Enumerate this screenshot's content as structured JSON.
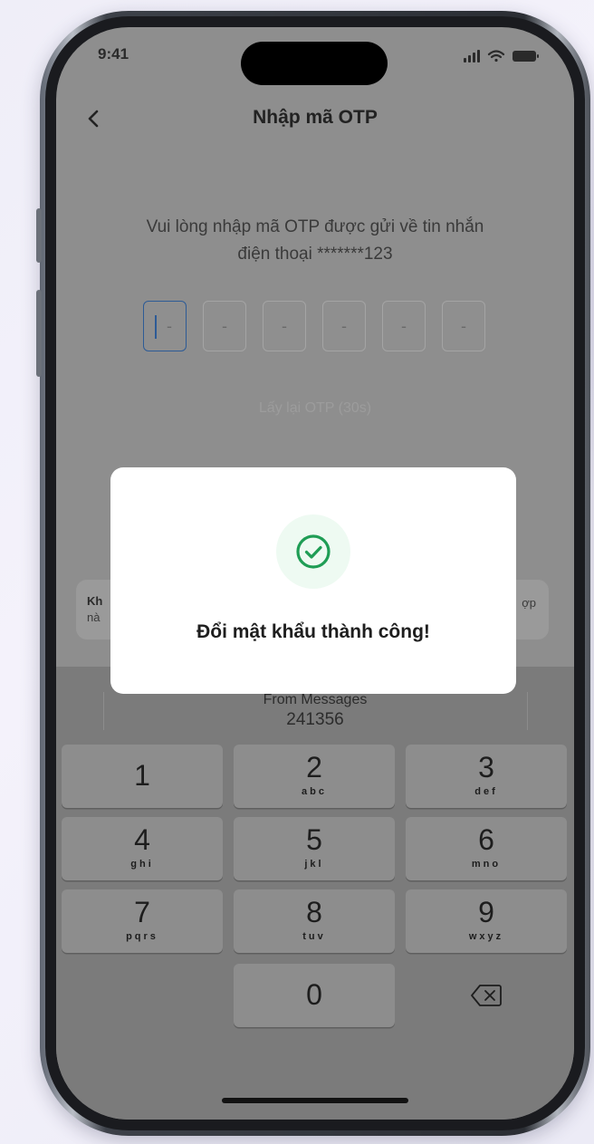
{
  "status_bar": {
    "time": "9:41"
  },
  "header": {
    "title": "Nhập mã OTP"
  },
  "instruction": {
    "line1": "Vui lòng nhập mã OTP được gửi về tin nhắn",
    "line2": "điện thoại *******123"
  },
  "otp": {
    "digits": [
      "-",
      "-",
      "-",
      "-",
      "-",
      "-"
    ]
  },
  "resend": {
    "label": "Lấy lại OTP (30s)"
  },
  "note": {
    "line1_fragment": "Kh",
    "line2_fragment": "nà",
    "right_fragment": "ợp"
  },
  "keyboard": {
    "suggestion": {
      "source": "From Messages",
      "code": "241356"
    },
    "keys": [
      {
        "num": "1",
        "letters": ""
      },
      {
        "num": "2",
        "letters": "abc"
      },
      {
        "num": "3",
        "letters": "def"
      },
      {
        "num": "4",
        "letters": "ghi"
      },
      {
        "num": "5",
        "letters": "jkl"
      },
      {
        "num": "6",
        "letters": "mno"
      },
      {
        "num": "7",
        "letters": "pqrs"
      },
      {
        "num": "8",
        "letters": "tuv"
      },
      {
        "num": "9",
        "letters": "wxyz"
      },
      {
        "num": "0",
        "letters": ""
      }
    ],
    "delete_icon": "backspace-icon"
  },
  "modal": {
    "icon": "check-circle-icon",
    "message": "Đổi mật khẩu thành công!",
    "success_color": "#1f9d55"
  }
}
